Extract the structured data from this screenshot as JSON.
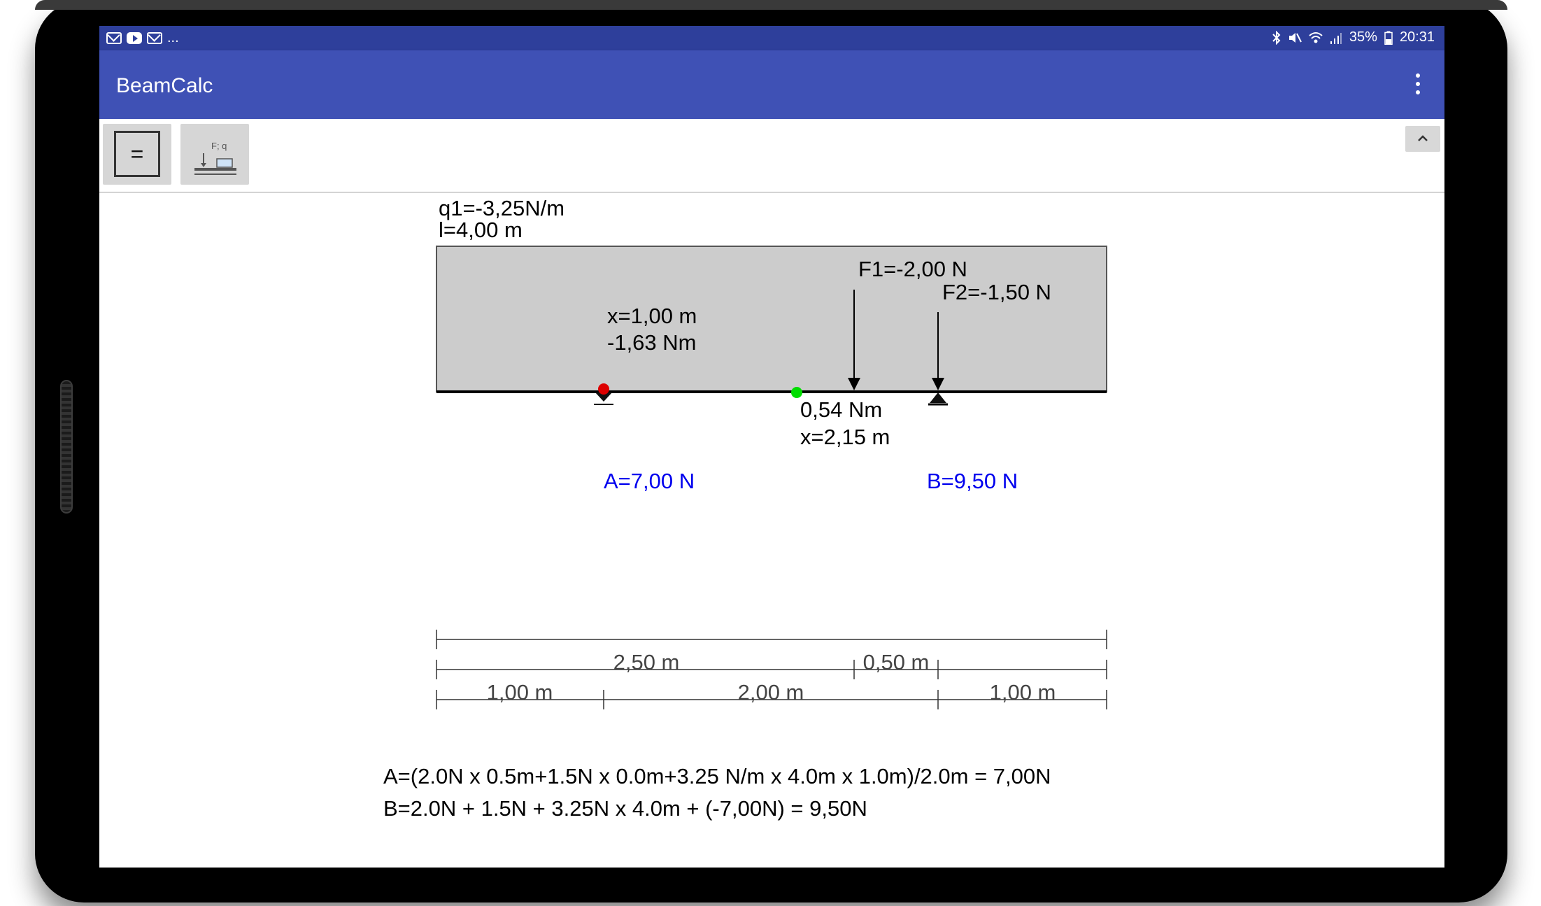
{
  "status_bar": {
    "left_icons": [
      "mail-icon",
      "youtube-icon",
      "mail-icon"
    ],
    "more": "...",
    "battery": "35%",
    "time": "20:31"
  },
  "app": {
    "title": "BeamCalc",
    "menu_icon": "more-vertical-icon"
  },
  "toolbar": {
    "calculate_label": "=",
    "loads_icon_text": "F; q",
    "collapse_icon": "chevron-up-icon"
  },
  "beam": {
    "q_label": "q1=-3,25N/m",
    "length_label": "l=4,00 m",
    "forces": [
      {
        "label": "F1=-2,00 N",
        "x_m": 2.5
      },
      {
        "label": "F2=-1,50 N",
        "x_m": 3.0
      }
    ],
    "supports": [
      {
        "label": "A=7,00 N",
        "x_m": 1.0
      },
      {
        "label": "B=9,50 N",
        "x_m": 3.0
      }
    ],
    "moment_points": [
      {
        "label_x": "x=1,00 m",
        "label_m": "-1,63 Nm",
        "x_m": 1.0,
        "color": "#e00000"
      },
      {
        "label_m": "0,54 Nm",
        "label_x": "x=2,15 m",
        "x_m": 2.15,
        "color": "#00dd00"
      }
    ],
    "fill_color": "#cccccc",
    "reaction_color": "#0000ee"
  },
  "dimensions": {
    "row2": [
      "2,50 m",
      "0,50 m"
    ],
    "row3": [
      "1,00 m",
      "2,00 m",
      "1,00 m"
    ]
  },
  "formulas": {
    "a": "A=(2.0N x 0.5m+1.5N x 0.0m+3.25 N/m x 4.0m x 1.0m)/2.0m = 7,00N",
    "b": "B=2.0N + 1.5N + 3.25N x 4.0m + (-7,00N) = 9,50N"
  }
}
